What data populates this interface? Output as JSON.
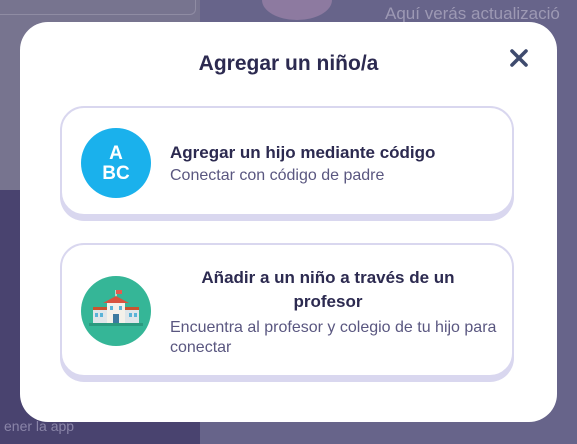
{
  "background": {
    "text_top": "Aquí verás actualizació",
    "text_bottom": "ener la app"
  },
  "modal": {
    "title": "Agregar un niño/a",
    "options": [
      {
        "icon": "abc-code-icon",
        "icon_letters_top": "A",
        "icon_letters_bottom": "BC",
        "title": "Agregar un hijo mediante código",
        "subtitle": "Conectar con código de padre"
      },
      {
        "icon": "school-building-icon",
        "title": "Añadir a un niño a través de un profesor",
        "subtitle": "Encuentra al profesor y colegio de tu hijo para conectar"
      }
    ]
  },
  "colors": {
    "accent_blue": "#1ab1ec",
    "accent_green": "#35b697",
    "title_text": "#2c2a50",
    "card_border": "#d9d7ef"
  }
}
